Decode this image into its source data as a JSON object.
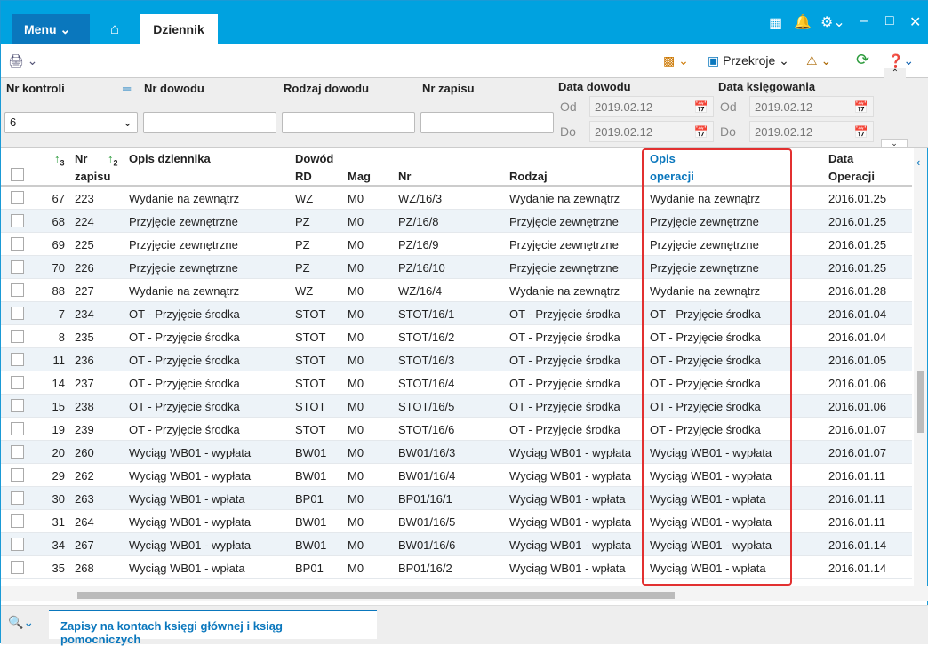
{
  "topbar": {
    "menu": "Menu",
    "tab": "Dziennik"
  },
  "toolbar": {
    "przekroje": "Przekroje"
  },
  "filters": {
    "nr_kontroli": "Nr kontroli",
    "nr_kontroli_value": "6",
    "nr_dowodu": "Nr dowodu",
    "rodzaj_dowodu": "Rodzaj dowodu",
    "nr_zapisu": "Nr zapisu",
    "data_dowodu": "Data dowodu",
    "data_ksiegowania": "Data księgowania",
    "od": "Od",
    "do": "Do",
    "dd_od": "2019.02.12",
    "dd_do": "2019.02.12",
    "dk_od": "2019.02.12",
    "dk_do": "2019.02.12"
  },
  "table": {
    "headers": {
      "sort1": "3",
      "nr": "Nr",
      "zapisu": "zapisu",
      "sort2": "2",
      "opis_dziennika": "Opis dziennika",
      "dowod": "Dowód",
      "rd": "RD",
      "mag": "Mag",
      "nr_dok": "Nr",
      "rodzaj": "Rodzaj",
      "opis": "Opis",
      "operacji": "operacji",
      "data": "Data",
      "data_op": "Operacji"
    },
    "rows": [
      [
        "67",
        "223",
        "Wydanie na zewnątrz",
        "WZ",
        "M0",
        "WZ/16/3",
        "Wydanie na zewnątrz",
        "Wydanie na zewnątrz",
        "2016.01.25"
      ],
      [
        "68",
        "224",
        "Przyjęcie zewnętrzne",
        "PZ",
        "M0",
        "PZ/16/8",
        "Przyjęcie zewnętrzne",
        "Przyjęcie zewnętrzne",
        "2016.01.25"
      ],
      [
        "69",
        "225",
        "Przyjęcie zewnętrzne",
        "PZ",
        "M0",
        "PZ/16/9",
        "Przyjęcie zewnętrzne",
        "Przyjęcie zewnętrzne",
        "2016.01.25"
      ],
      [
        "70",
        "226",
        "Przyjęcie zewnętrzne",
        "PZ",
        "M0",
        "PZ/16/10",
        "Przyjęcie zewnętrzne",
        "Przyjęcie zewnętrzne",
        "2016.01.25"
      ],
      [
        "88",
        "227",
        "Wydanie na zewnątrz",
        "WZ",
        "M0",
        "WZ/16/4",
        "Wydanie na zewnątrz",
        "Wydanie na zewnątrz",
        "2016.01.28"
      ],
      [
        "7",
        "234",
        "OT - Przyjęcie środka",
        "STOT",
        "M0",
        "STOT/16/1",
        "OT - Przyjęcie środka",
        "OT - Przyjęcie środka",
        "2016.01.04"
      ],
      [
        "8",
        "235",
        "OT - Przyjęcie środka",
        "STOT",
        "M0",
        "STOT/16/2",
        "OT - Przyjęcie środka",
        "OT - Przyjęcie środka",
        "2016.01.04"
      ],
      [
        "11",
        "236",
        "OT - Przyjęcie środka",
        "STOT",
        "M0",
        "STOT/16/3",
        "OT - Przyjęcie środka",
        "OT - Przyjęcie środka",
        "2016.01.05"
      ],
      [
        "14",
        "237",
        "OT - Przyjęcie środka",
        "STOT",
        "M0",
        "STOT/16/4",
        "OT - Przyjęcie środka",
        "OT - Przyjęcie środka",
        "2016.01.06"
      ],
      [
        "15",
        "238",
        "OT - Przyjęcie środka",
        "STOT",
        "M0",
        "STOT/16/5",
        "OT - Przyjęcie środka",
        "OT - Przyjęcie środka",
        "2016.01.06"
      ],
      [
        "19",
        "239",
        "OT - Przyjęcie środka",
        "STOT",
        "M0",
        "STOT/16/6",
        "OT - Przyjęcie środka",
        "OT - Przyjęcie środka",
        "2016.01.07"
      ],
      [
        "20",
        "260",
        "Wyciąg WB01 - wypłata",
        "BW01",
        "M0",
        "BW01/16/3",
        "Wyciąg WB01 - wypłata",
        "Wyciąg WB01 - wypłata",
        "2016.01.07"
      ],
      [
        "29",
        "262",
        "Wyciąg WB01 - wypłata",
        "BW01",
        "M0",
        "BW01/16/4",
        "Wyciąg WB01 - wypłata",
        "Wyciąg WB01 - wypłata",
        "2016.01.11"
      ],
      [
        "30",
        "263",
        "Wyciąg WB01 - wpłata",
        "BP01",
        "M0",
        "BP01/16/1",
        "Wyciąg WB01 - wpłata",
        "Wyciąg WB01 - wpłata",
        "2016.01.11"
      ],
      [
        "31",
        "264",
        "Wyciąg WB01 - wypłata",
        "BW01",
        "M0",
        "BW01/16/5",
        "Wyciąg WB01 - wypłata",
        "Wyciąg WB01 - wypłata",
        "2016.01.11"
      ],
      [
        "34",
        "267",
        "Wyciąg WB01 - wypłata",
        "BW01",
        "M0",
        "BW01/16/6",
        "Wyciąg WB01 - wypłata",
        "Wyciąg WB01 - wypłata",
        "2016.01.14"
      ],
      [
        "35",
        "268",
        "Wyciąg WB01 - wpłata",
        "BP01",
        "M0",
        "BP01/16/2",
        "Wyciąg WB01 - wpłata",
        "Wyciąg WB01 - wpłata",
        "2016.01.14"
      ]
    ]
  },
  "bottom": {
    "tab": "Zapisy na kontach księgi głównej i ksiąg pomocniczych"
  }
}
